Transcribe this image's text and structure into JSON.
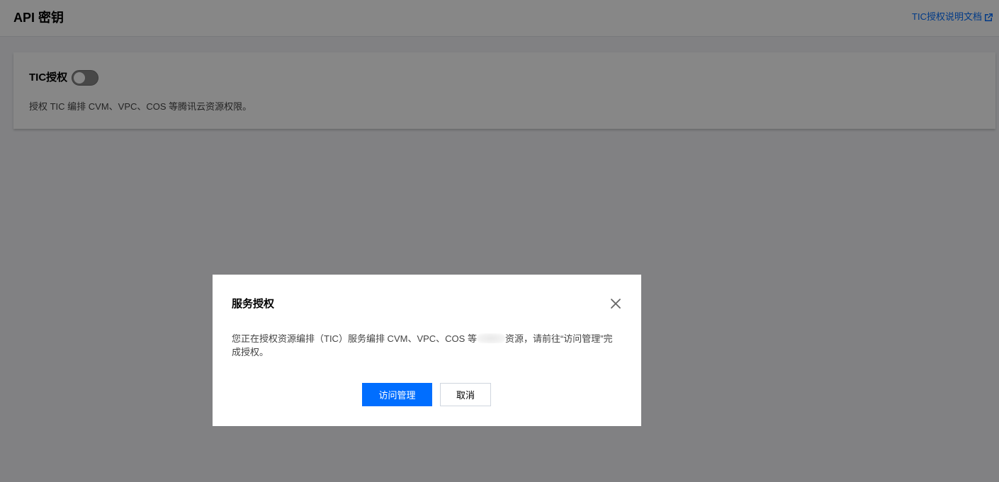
{
  "header": {
    "title": "API 密钥",
    "doc_link": "TIC授权说明文档",
    "doc_link_icon": "external-link-icon"
  },
  "card": {
    "title": "TIC授权",
    "toggle_state": "off",
    "description": "授权 TIC 编排 CVM、VPC、COS 等腾讯云资源权限。"
  },
  "dialog": {
    "title": "服务授权",
    "close_icon": "close-icon",
    "body_before": "您正在授权资源编排（TIC）服务编排 CVM、VPC、COS 等",
    "body_after": "资源，请前往“访问管理”完成授权。",
    "confirm_label": "访问管理",
    "cancel_label": "取消"
  },
  "colors": {
    "primary": "#006eff",
    "overlay": "rgba(0,0,0,0.47)",
    "toggle_off": "#888888"
  }
}
